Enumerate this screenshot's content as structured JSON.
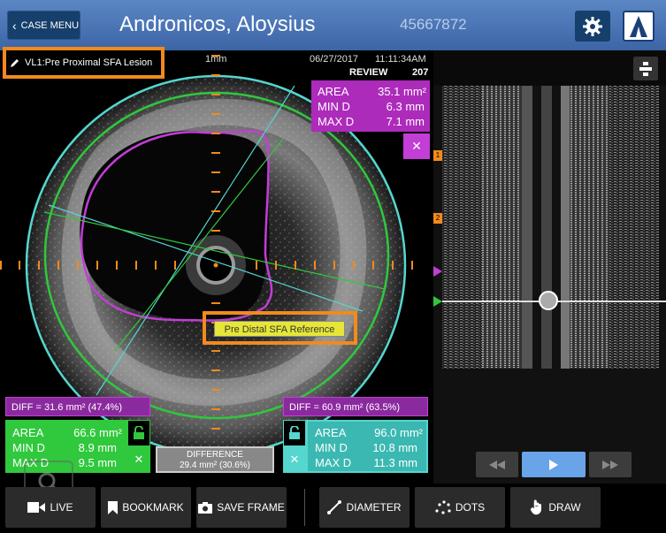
{
  "header": {
    "case_menu": "CASE MENU",
    "patient_name": "Andronicos, Aloysius",
    "patient_id": "45667872"
  },
  "lesion_label": "VL1:Pre Proximal SFA Lesion",
  "top_info": {
    "scale": "1mm",
    "date": "06/27/2017",
    "time": "11:11:34AM",
    "mode": "REVIEW",
    "frame": "207"
  },
  "measure_top": {
    "area_label": "AREA",
    "area_value": "35.1 mm²",
    "mind_label": "MIN D",
    "mind_value": "6.3 mm",
    "maxd_label": "MAX D",
    "maxd_value": "7.1 mm"
  },
  "reference_label": "Pre Distal SFA Reference",
  "left_panel": {
    "diff": "DIFF = 31.6 mm² (47.4%)",
    "area_label": "AREA",
    "area_value": "66.6 mm²",
    "mind_label": "MIN D",
    "mind_value": "8.9 mm",
    "maxd_label": "MAX D",
    "maxd_value": "9.5 mm"
  },
  "right_panel": {
    "diff": "DIFF = 60.9 mm² (63.5%)",
    "area_label": "AREA",
    "area_value": "96.0 mm²",
    "mind_label": "MIN D",
    "mind_value": "10.8 mm",
    "maxd_label": "MAX D",
    "maxd_value": "11.3 mm"
  },
  "difference": {
    "title": "DIFFERENCE",
    "value": "29.4 mm² (30.6%)"
  },
  "longitudinal_markers": [
    "1",
    "2"
  ],
  "toolbar": {
    "live": "LIVE",
    "bookmark": "BOOKMARK",
    "save_frame": "SAVE FRAME",
    "diameter": "DIAMETER",
    "dots": "DOTS",
    "draw": "DRAW"
  },
  "colors": {
    "header": "#4a76b8",
    "orange_highlight": "#f28a1c",
    "purple": "#ad2bbb",
    "green": "#30c83c",
    "cyan": "#55d6cf",
    "play_blue": "#69a4e8"
  }
}
